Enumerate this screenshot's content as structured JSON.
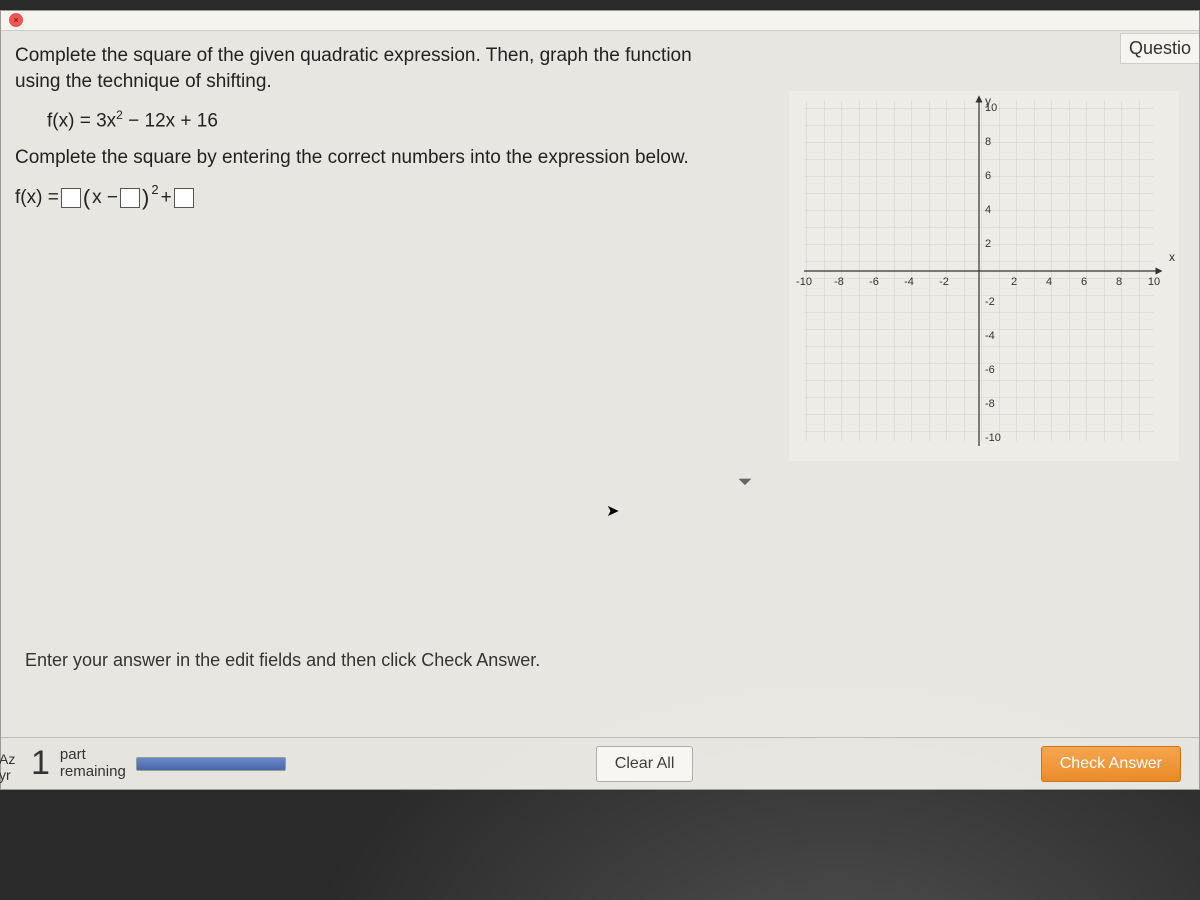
{
  "header": {
    "question_tag": "Questio"
  },
  "problem": {
    "instruction": "Complete the square of the given quadratic expression. Then, graph the function using the technique of shifting.",
    "equation_pre": "f(x) = 3x",
    "equation_exp": "2",
    "equation_post": " − 12x + 16",
    "sub_instruction": "Complete the square by entering the correct numbers into the expression below.",
    "answer_prefix": "f(x) =",
    "lparen": "(",
    "var": "x −",
    "rparen": ")",
    "exp2": "2",
    "plus": " +"
  },
  "graph": {
    "y_label": "y",
    "x_label": "x",
    "x_ticks": [
      "-10",
      "-8",
      "-6",
      "-4",
      "-2",
      "2",
      "4",
      "6",
      "8",
      "10"
    ],
    "y_ticks": [
      "10",
      "8",
      "6",
      "4",
      "2",
      "-2",
      "-4",
      "-6",
      "-8",
      "-10"
    ]
  },
  "footer": {
    "hint": "Enter your answer in the edit fields and then click Check Answer.",
    "side1": "Az",
    "side2": "yr",
    "count": "1",
    "part": "part",
    "remaining": "remaining",
    "clear": "Clear All",
    "check": "Check Answer"
  }
}
